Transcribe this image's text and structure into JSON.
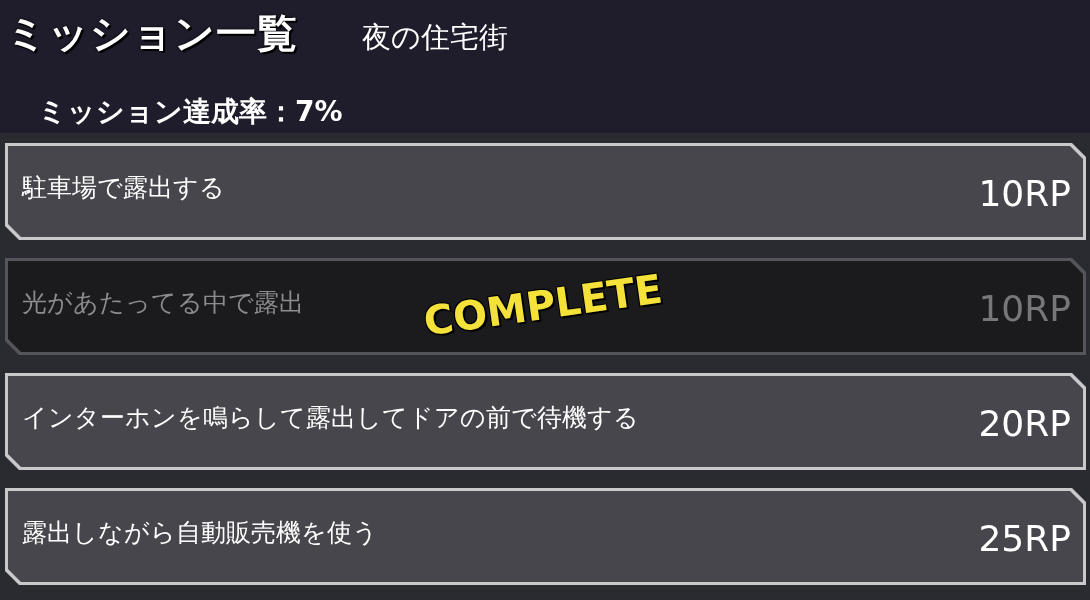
{
  "header": {
    "title": "ミッション一覧",
    "area": "夜の住宅街",
    "progress": "ミッション達成率：7%"
  },
  "missions": [
    {
      "name": "駐車場で露出する",
      "reward": "10RP",
      "completed": false
    },
    {
      "name": "光があたってる中で露出",
      "reward": "10RP",
      "completed": true,
      "stamp": "COMPLETE"
    },
    {
      "name": "インターホンを鳴らして露出してドアの前で待機する",
      "reward": "20RP",
      "completed": false
    },
    {
      "name": "露出しながら自動販売機を使う",
      "reward": "25RP",
      "completed": false
    }
  ]
}
